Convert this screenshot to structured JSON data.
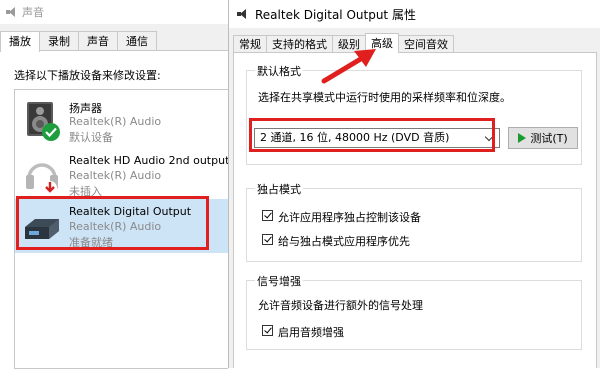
{
  "sound_dialog": {
    "title": "声音",
    "tabs": [
      {
        "label": "播放",
        "active": true
      },
      {
        "label": "录制",
        "active": false
      },
      {
        "label": "声音",
        "active": false
      },
      {
        "label": "通信",
        "active": false
      }
    ],
    "instruction": "选择以下播放设备来修改设置:",
    "devices": [
      {
        "name": "扬声器",
        "driver": "Realtek(R) Audio",
        "status": "默认设备",
        "icon": "speaker-icon",
        "badge": "check-badge-icon",
        "selected": false
      },
      {
        "name": "Realtek HD Audio 2nd output",
        "driver": "Realtek(R) Audio",
        "status": "未插入",
        "icon": "headphones-icon",
        "badge": "down-arrow-badge-icon",
        "selected": false
      },
      {
        "name": "Realtek Digital Output",
        "driver": "Realtek(R) Audio",
        "status": "准备就绪",
        "icon": "digital-output-icon",
        "badge": "",
        "selected": true
      }
    ]
  },
  "properties_dialog": {
    "title": "Realtek Digital Output 属性",
    "tabs": [
      {
        "label": "常规",
        "active": false
      },
      {
        "label": "支持的格式",
        "active": false
      },
      {
        "label": "级别",
        "active": false
      },
      {
        "label": "高级",
        "active": true
      },
      {
        "label": "空间音效",
        "active": false
      }
    ],
    "default_format": {
      "legend": "默认格式",
      "description": "选择在共享模式中运行时使用的采样频率和位深度。",
      "selected_format": "2 通道, 16 位, 48000 Hz (DVD 音质)",
      "test_button": "测试(T)"
    },
    "exclusive_mode": {
      "legend": "独占模式",
      "options": [
        {
          "label": "允许应用程序独占控制该设备",
          "checked": true
        },
        {
          "label": "给与独占模式应用程序优先",
          "checked": true
        }
      ]
    },
    "signal_enhancement": {
      "legend": "信号增强",
      "description": "允许音频设备进行额外的信号处理",
      "option": {
        "label": "启用音频增强",
        "checked": true
      }
    }
  },
  "colors": {
    "highlight_box": "#e0201f",
    "selection": "#cde3f6",
    "play_green": "#1a9b2e"
  }
}
